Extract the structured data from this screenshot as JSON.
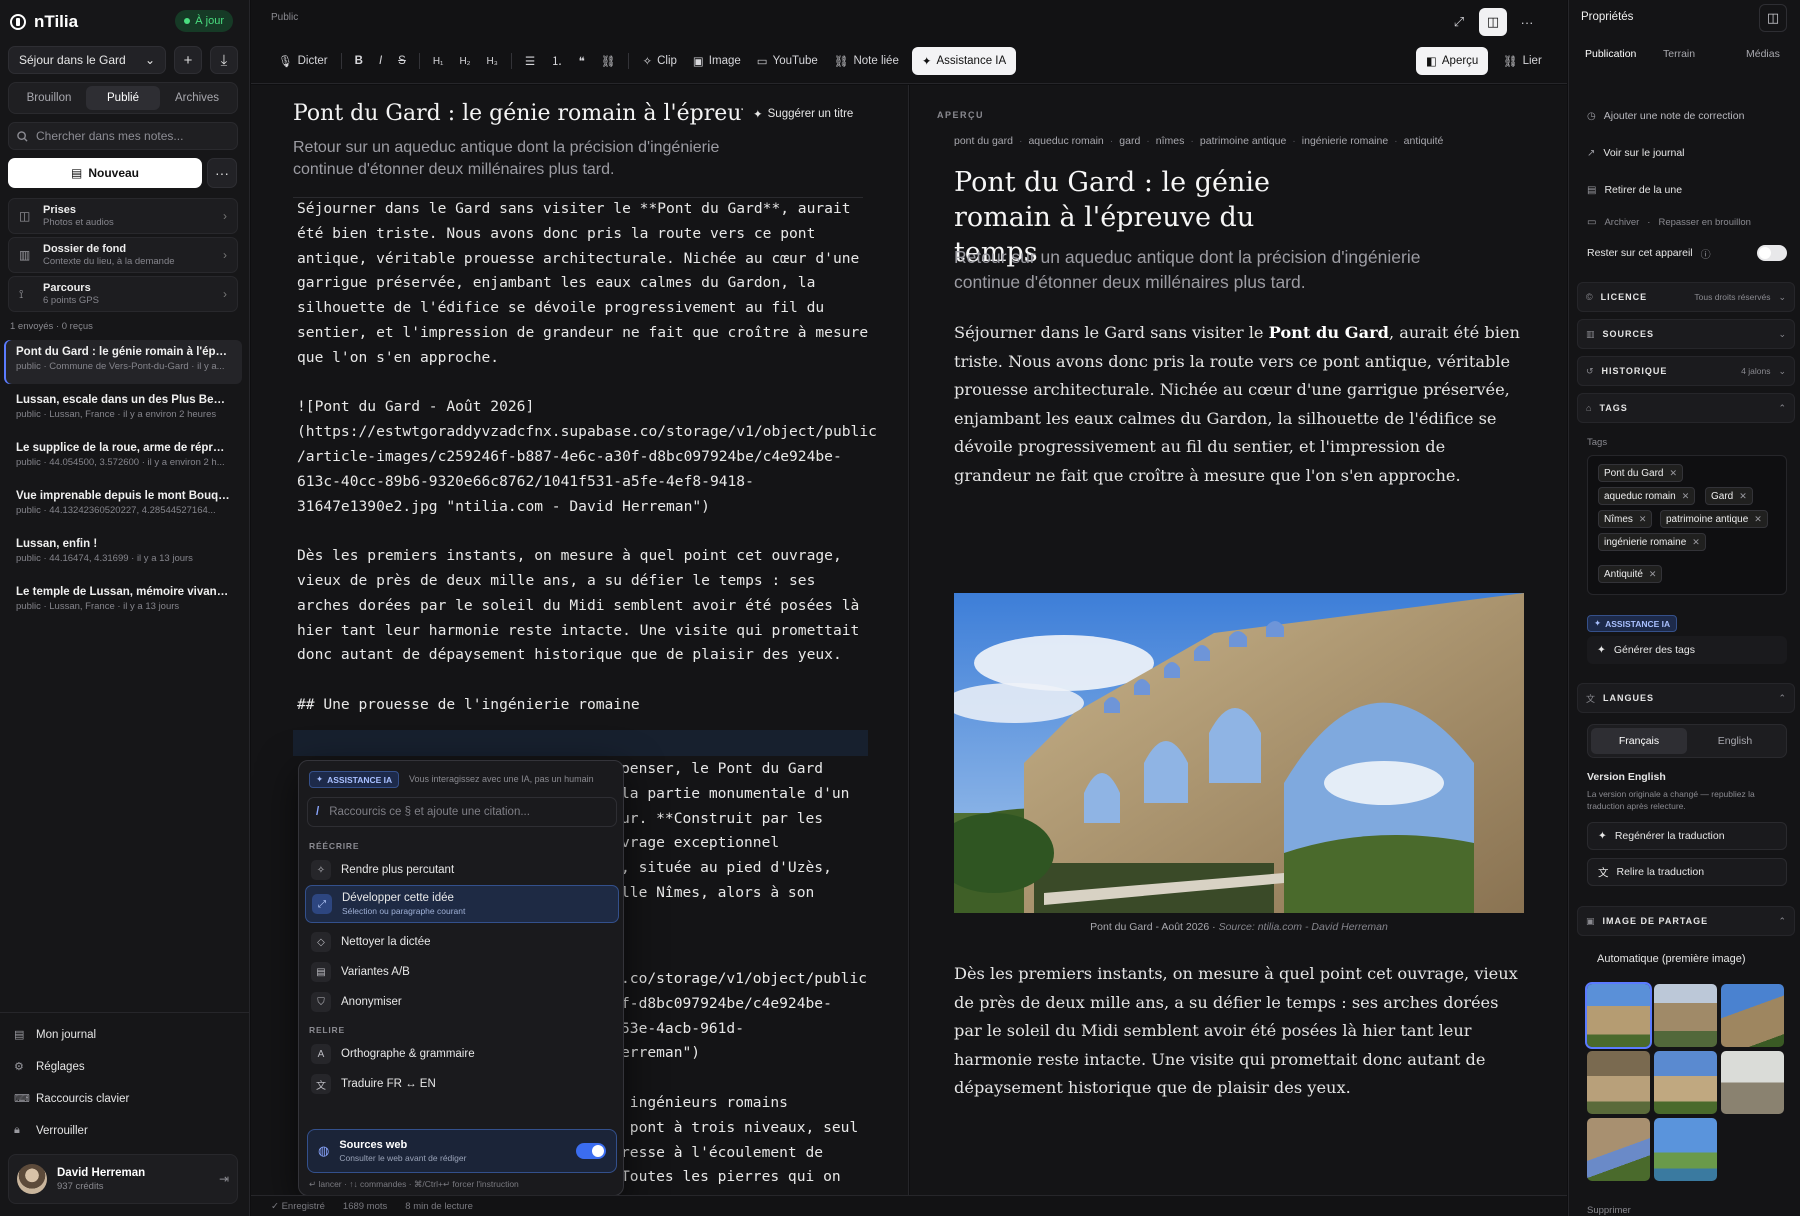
{
  "app": {
    "name": "nTilia",
    "status": "À jour"
  },
  "sidebar": {
    "project": "Séjour dans le Gard",
    "filters": [
      "Brouillon",
      "Publié",
      "Archives"
    ],
    "search_placeholder": "Chercher dans mes notes...",
    "new_label": "Nouveau",
    "quick": [
      {
        "title": "Prises",
        "sub": "Photos et audios"
      },
      {
        "title": "Dossier de fond",
        "sub": "Contexte du lieu, à la demande"
      },
      {
        "title": "Parcours",
        "sub": "6 points GPS"
      }
    ],
    "counts": "1 envoyés · 0 reçus",
    "notes": [
      {
        "title": "Pont du Gard : le génie romain à l'épreuv...",
        "meta": "public · Commune de Vers-Pont-du-Gard · il y a..."
      },
      {
        "title": "Lussan, escale dans un des Plus Beaux V...",
        "meta": "public · Lussan, France · il y a environ 2 heures"
      },
      {
        "title": "Le supplice de la roue, arme de répressio...",
        "meta": "public · 44.054500, 3.572600 · il y a environ 2 h..."
      },
      {
        "title": "Vue imprenable depuis le mont Bouquet",
        "meta": "public · 44.13242360520227, 4.28544527164..."
      },
      {
        "title": "Lussan, enfin !",
        "meta": "public · 44.16474, 4.31699 · il y a 13 jours"
      },
      {
        "title": "Le temple de Lussan, mémoire vivante du...",
        "meta": "public · Lussan, France · il y a 13 jours"
      }
    ],
    "nav": [
      "Mon journal",
      "Réglages",
      "Raccourcis clavier",
      "Verrouiller"
    ],
    "user": {
      "name": "David Herreman",
      "credits": "937 crédits"
    }
  },
  "topbar": {
    "crumb": "Public",
    "tools": {
      "dictate": "Dicter",
      "h1": "H₁",
      "h2": "H₂",
      "h3": "H₃",
      "clip": "Clip",
      "image": "Image",
      "youtube": "YouTube",
      "linked": "Note liée",
      "ai": "Assistance IA"
    },
    "preview_btn": "Aperçu",
    "link_btn": "Lier"
  },
  "editor": {
    "title": "Pont du Gard : le génie romain à l'épreuve du temps",
    "suggest": "Suggérer un titre",
    "subtitle": "Retour sur un aqueduc antique dont la précision d'ingénierie continue d'étonner deux millénaires plus tard.",
    "code_top": "Séjourner dans le Gard sans visiter le **Pont du Gard**, aurait\nété bien triste. Nous avons donc pris la route vers ce pont\nantique, véritable prouesse architecturale. Nichée au cœur d'une\ngarrigue préservée, enjambant les eaux calmes du Gardon, la\nsilhouette de l'édifice se dévoile progressivement au fil du\nsentier, et l'impression de grandeur ne fait que croître à mesure\nque l'on s'en approche.\n\n![Pont du Gard - Août 2026]\n(https://estwtgoraddyvzadcfnx.supabase.co/storage/v1/object/public\n/article-images/c259246f-b887-4e6c-a30f-d8bc097924be/c4e924be-\n613c-40cc-89b6-9320e66c8762/1041f531-a5fe-4ef8-9418-\n31647e1390e2.jpg \"ntilia.com - David Herreman\")\n\nDès les premiers instants, on mesure à quel point cet ouvrage,\nvieux de près de deux mille ans, a su défier le temps : ses\narches dorées par le soleil du Midi semblent avoir été posées là\nhier tant leur harmonie reste intacte. Une visite qui promettait\ndonc autant de dépaysement historique que de plaisir des yeux.\n\n## Une prouesse de l'ingénierie romaine",
    "code_mid": "penser, le Pont du Gard\nla partie monumentale d'un\nur. **Construit par les\nvrage exceptionnel\n, située au pied d'Uzès,\nlle Nîmes, alors à son",
    "code_low": ".co/storage/v1/object/public\nf-d8bc097924be/c4e924be-\n53e-4acb-961d-\nerreman\")\n\n ingénieurs romains\n pont à trois niveaux, seul\nresse à l'écoulement de\nToutes les pierres qui on"
  },
  "ai_popup": {
    "tag": "ASSISTANCE IA",
    "hint": "Vous interagissez avec une IA, pas un humain",
    "placeholder": "Raccourcis ce § et ajoute une citation...",
    "section_rewrite": "RÉÉCRIRE",
    "rewrite": [
      "Rendre plus percutant",
      "Développer cette idée",
      "Nettoyer la dictée",
      "Variantes A/B",
      "Anonymiser"
    ],
    "develop_sub": "Sélection ou paragraphe courant",
    "section_review": "RELIRE",
    "review": [
      "Orthographe & grammaire",
      "Traduire FR ↔ EN"
    ],
    "web_title": "Sources web",
    "web_sub": "Consulter le web avant de rédiger",
    "footer": "↵ lancer · ↑↓ commandes · ⌘/Ctrl+↵ forcer l'instruction"
  },
  "status": {
    "saved": "✓ Enregistré",
    "words": "1689 mots",
    "read": "8 min de lecture"
  },
  "preview": {
    "label": "APERÇU",
    "tags": [
      "pont du gard",
      "aqueduc romain",
      "gard",
      "nîmes",
      "patrimoine antique",
      "ingénierie romaine",
      "antiquité"
    ],
    "title": "Pont du Gard : le génie romain à l'épreuve du temps",
    "subtitle": "Retour sur un aqueduc antique dont la précision d'ingénierie continue d'étonner deux millénaires plus tard.",
    "p1_a": "Séjourner dans le Gard sans visiter le ",
    "p1_b": "Pont du Gard",
    "p1_c": ", aurait été bien triste. Nous avons donc pris la route vers ce pont antique, véritable prouesse architecturale. Nichée au cœur d'une garrigue préservée, enjambant les eaux calmes du Gardon, la silhouette de l'édifice se dévoile progressivement au fil du sentier, et l'impression de grandeur ne fait que croître à mesure que l'on s'en approche.",
    "caption": "Pont du Gard - Août 2026",
    "source": "Source: ntilia.com - David Herreman",
    "p2": "Dès les premiers instants, on mesure à quel point cet ouvrage, vieux de près de deux mille ans, a su défier le temps : ses arches dorées par le soleil du Midi semblent avoir été posées là hier tant leur harmonie reste intacte. Une visite qui promettait donc autant de dépaysement historique que de plaisir des yeux."
  },
  "props": {
    "title": "Propriétés",
    "tabs": [
      "Publication",
      "Terrain",
      "Médias"
    ],
    "actions": [
      "Ajouter une note de correction",
      "Voir sur le journal",
      "Retirer de la une"
    ],
    "archive": "Archiver",
    "redraft": "Repasser en brouillon",
    "stay": "Rester sur cet appareil",
    "licence": {
      "label": "LICENCE",
      "value": "Tous droits réservés"
    },
    "sources": "SOURCES",
    "history": {
      "label": "HISTORIQUE",
      "value": "4 jalons"
    },
    "tags_label": "TAGS",
    "tags_field": "Tags",
    "tags": [
      "Pont du Gard",
      "aqueduc romain",
      "Gard",
      "Nîmes",
      "patrimoine antique",
      "ingénierie romaine",
      "Antiquité"
    ],
    "ai_tag": "ASSISTANCE IA",
    "gen_tags": "Générer des tags",
    "languages": "LANGUES",
    "lang_opts": [
      "Français",
      "English"
    ],
    "version_title": "Version English",
    "version_note": "La version originale a changé — republiez la traduction après relecture.",
    "regen": "Regénérer la traduction",
    "reread": "Relire la traduction",
    "share_label": "IMAGE DE PARTAGE",
    "share_auto": "Automatique (première image)",
    "delete": "Supprimer"
  }
}
